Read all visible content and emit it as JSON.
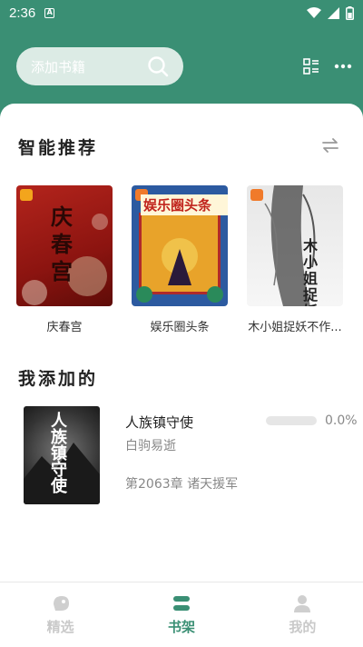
{
  "status_bar": {
    "time": "2:36",
    "notification_letter": "A"
  },
  "top_bar": {
    "search_placeholder": "添加书籍"
  },
  "recommend": {
    "title": "智能推荐",
    "books": [
      {
        "title": "庆春宫",
        "cover_text": "庆春宫"
      },
      {
        "title": "娱乐圈头条",
        "cover_text": "娱乐圈头条"
      },
      {
        "title": "木小姐捉妖不作...",
        "cover_text": "木小姐捉妖"
      }
    ]
  },
  "added": {
    "title": "我添加的",
    "books": [
      {
        "name": "人族镇守使",
        "author": "白驹易逝",
        "chapter": "第2063章 诸天援军",
        "progress_text": "0.0%",
        "progress": 0.0,
        "cover_text": "人族镇守使"
      }
    ]
  },
  "bottom_nav": {
    "items": [
      {
        "label": "精选",
        "icon": "featured-icon",
        "active": false
      },
      {
        "label": "书架",
        "icon": "bookshelf-icon",
        "active": true
      },
      {
        "label": "我的",
        "icon": "profile-icon",
        "active": false
      }
    ]
  },
  "colors": {
    "accent": "#3a8f74",
    "header_bg": "#3a8f74"
  }
}
